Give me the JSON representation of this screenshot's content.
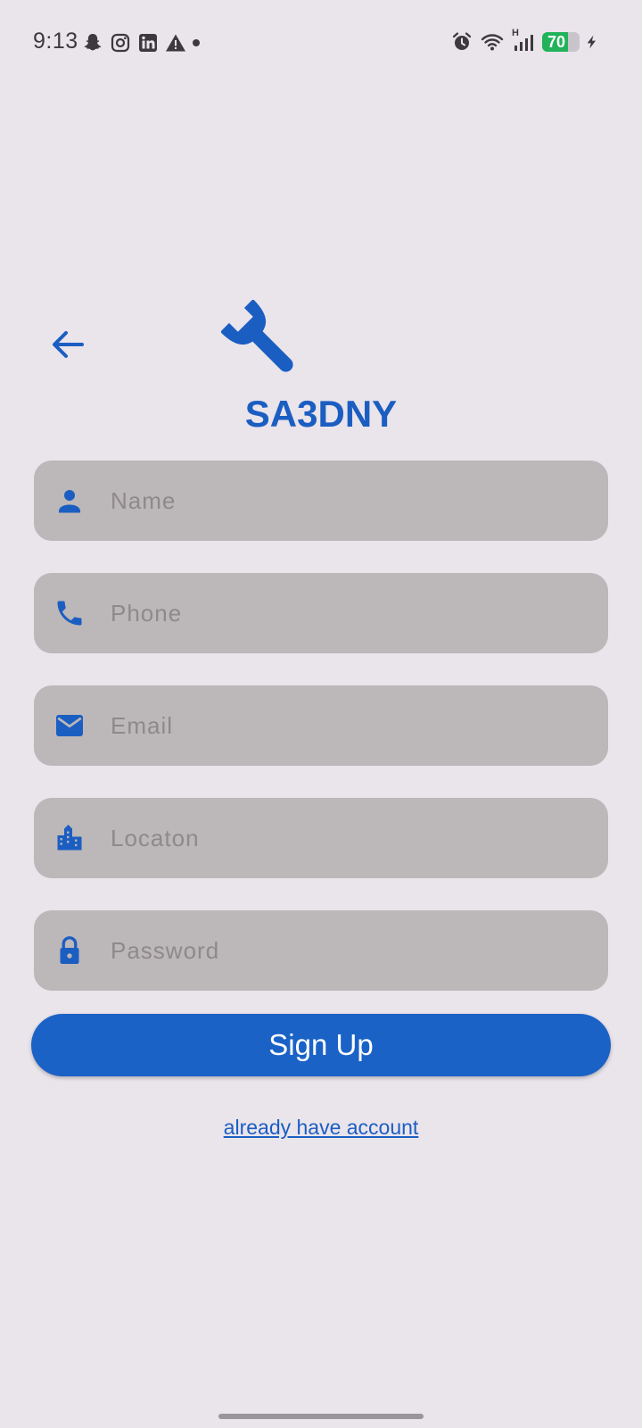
{
  "status_bar": {
    "time": "9:13",
    "left_icons": [
      "snapchat-icon",
      "instagram-icon",
      "linkedin-icon",
      "warning-icon"
    ],
    "right_icons": [
      "alarm-icon",
      "wifi-icon",
      "signal-icon"
    ],
    "network_type": "H",
    "battery_level": "70",
    "battery_fraction": 0.7,
    "charging": true
  },
  "header": {
    "back_icon": "arrow-back-icon",
    "logo_icon": "wrench-icon",
    "app_title": "SA3DNY"
  },
  "form": {
    "fields": [
      {
        "icon": "person-icon",
        "placeholder": "Name",
        "value": ""
      },
      {
        "icon": "phone-icon",
        "placeholder": "Phone",
        "value": ""
      },
      {
        "icon": "email-icon",
        "placeholder": "Email",
        "value": ""
      },
      {
        "icon": "city-icon",
        "placeholder": "Locaton",
        "value": ""
      },
      {
        "icon": "lock-icon",
        "placeholder": "Password",
        "value": ""
      }
    ],
    "submit_label": "Sign Up",
    "login_link": "already have account"
  },
  "colors": {
    "background": "#EAE4EB",
    "accent": "#1B5EC2",
    "field_background": "#BCB7B8",
    "placeholder": "#8E898B",
    "battery_green": "#22B35A"
  }
}
